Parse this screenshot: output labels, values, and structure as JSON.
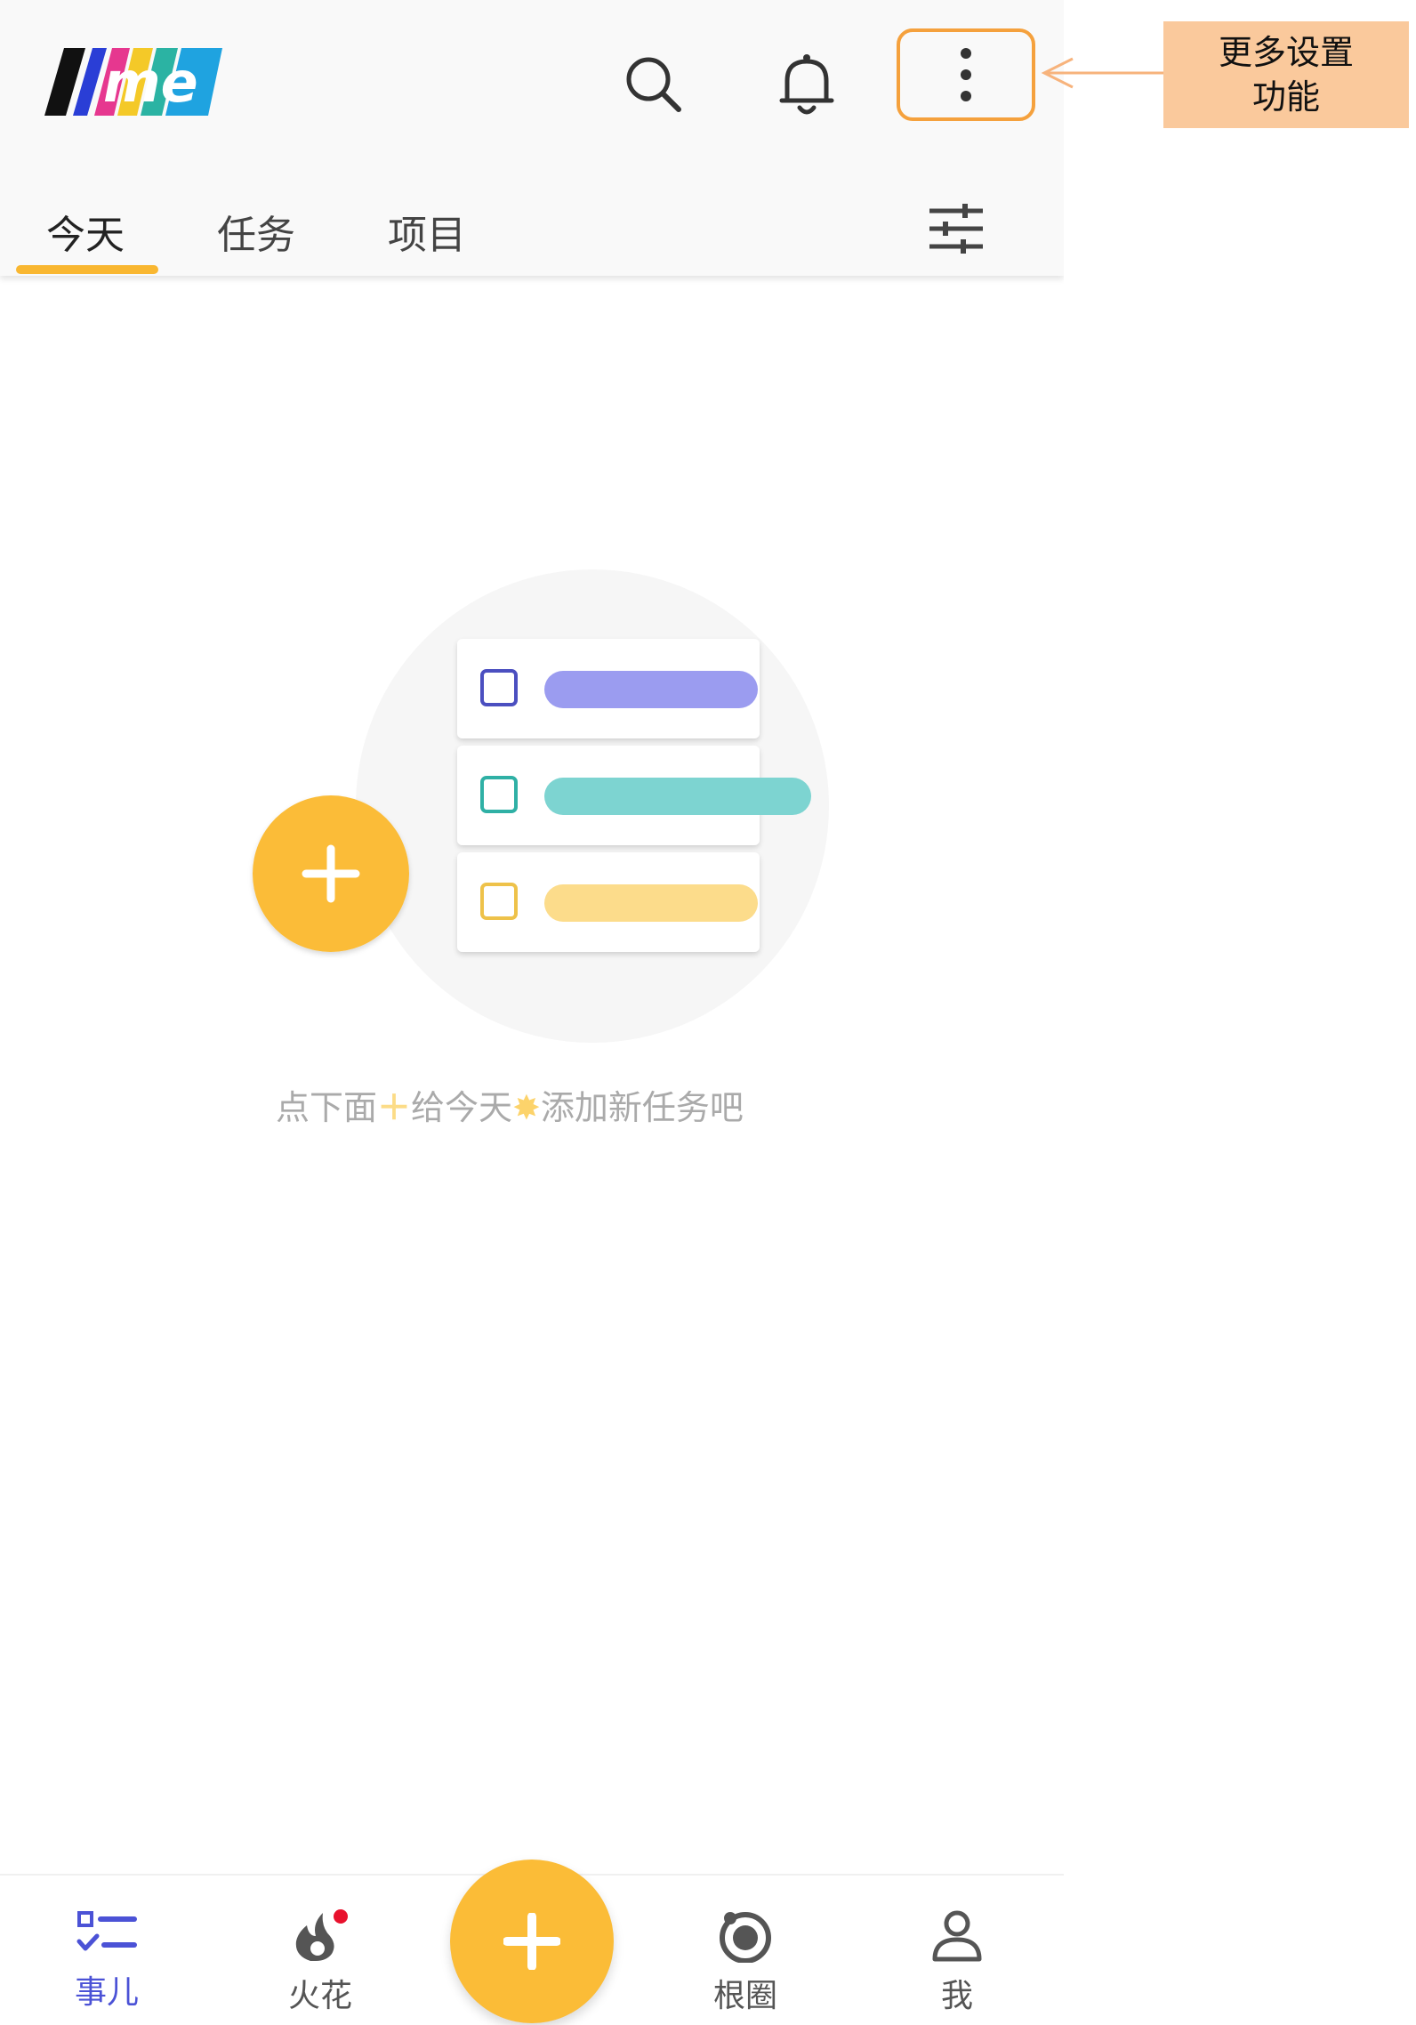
{
  "header": {
    "logo_text": "me",
    "search_icon": "search-icon",
    "bell_icon": "bell-icon",
    "more_icon": "more-vertical-icon",
    "filter_icon": "sliders-icon"
  },
  "tabs": [
    {
      "label": "今天",
      "active": true
    },
    {
      "label": "任务",
      "active": false
    },
    {
      "label": "项目",
      "active": false
    }
  ],
  "callout": {
    "line1": "更多设置",
    "line2": "功能"
  },
  "empty_state": {
    "hint_part1": "点下面",
    "hint_plus": "＋",
    "hint_part2": "给今天",
    "hint_sun": "✸",
    "hint_part3": "添加新任务吧"
  },
  "bottom_nav": {
    "items": [
      {
        "label": "事儿",
        "icon": "checklist-icon",
        "active": true
      },
      {
        "label": "火花",
        "icon": "flame-icon",
        "active": false,
        "badge": true
      },
      {
        "label": "根圈",
        "icon": "orbit-icon",
        "active": false
      },
      {
        "label": "我",
        "icon": "person-icon",
        "active": false
      }
    ],
    "fab_icon": "plus-icon"
  },
  "colors": {
    "accent_yellow": "#fbbc37",
    "active_blue": "#4b52d6",
    "callout_bg": "#fac99c",
    "highlight_border": "#f5a13d",
    "badge_red": "#e8112d"
  }
}
